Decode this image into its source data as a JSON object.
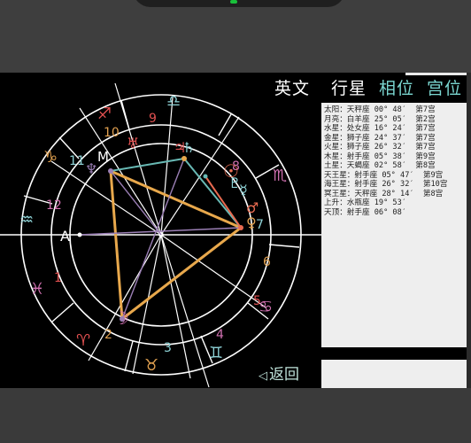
{
  "nav": {
    "english": "英文",
    "planets": "行星",
    "aspects": "相位",
    "houses": "宫位",
    "back": "返回"
  },
  "chart": {
    "ascendant_label": "A",
    "midheaven_label": "M",
    "house_numbers": [
      "1",
      "2",
      "3",
      "4",
      "5",
      "6",
      "7",
      "8",
      "9",
      "10",
      "11",
      "12"
    ],
    "zodiac_glyphs": [
      "♈",
      "♉",
      "♊",
      "♋",
      "♌",
      "♍",
      "♎",
      "♏",
      "♐",
      "♑",
      "♒",
      "♓"
    ],
    "planet_glyphs": {
      "sun": "☉",
      "moon": "☽",
      "mercury": "☿",
      "venus": "♀",
      "mars": "♂",
      "jupiter": "♃",
      "saturn": "♄",
      "uranus": "♅",
      "neptune": "♆",
      "pluto": "♇"
    },
    "colors": {
      "wheel": "#ffffff",
      "fire": "#e05050",
      "earth": "#e0a050",
      "air": "#8fd4d8",
      "water": "#d070b0",
      "trine": "#e8a84c",
      "sextile": "#68b9b4",
      "square": "#9b7fb5",
      "conjunct": "#e86a50"
    }
  },
  "planet_positions": [
    {
      "label": "太阳：天秤座 00° 48′  第7宫"
    },
    {
      "label": "月亮：白羊座 25° 05′  第2宫"
    },
    {
      "label": "水星：处女座 16° 24′  第7宫"
    },
    {
      "label": "金星：狮子座 24° 37′  第7宫"
    },
    {
      "label": "火星：狮子座 26° 32′  第7宫"
    },
    {
      "label": "木星：射手座 05° 38′  第9宫"
    },
    {
      "label": "土星：天蝎座 02° 58′  第8宫"
    },
    {
      "label": "天王星：射手座 05° 47′  第9宫"
    },
    {
      "label": "海王星：射手座 26° 32′  第10宫"
    },
    {
      "label": "冥王星：天秤座 28° 14′  第8宫"
    },
    {
      "label": "上升：水瓶座 19° 53′"
    },
    {
      "label": "天顶：射手座 06° 08′"
    }
  ]
}
